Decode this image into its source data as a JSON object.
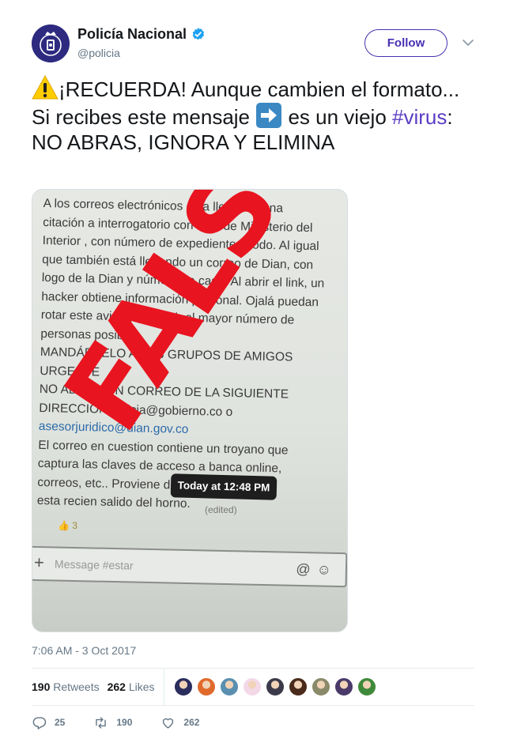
{
  "account": {
    "display_name": "Policía Nacional",
    "handle": "@policia",
    "follow_label": "Follow"
  },
  "tweet": {
    "text_part1": "¡RECUERDA! Aunque cambien el formato... Si recibes este mensaje ",
    "text_part2": " es un viejo ",
    "hashtag": "#virus",
    "text_part3": ": NO ABRAS, IGNORA Y ELIMINA",
    "emojis": [
      "warning-emoji",
      "right-arrow-emoji"
    ]
  },
  "media": {
    "lines": [
      "A los correos electrónicos esta llegando una",
      "citación a interrogatorio con logo de Ministerio del",
      "Interior , con número de expediente y todo. Al igual",
      "que también está llegando un correo de Dian, con",
      "logo de la Dian y número de caso. Al abrir el link, un",
      "hacker obtiene información personal. Ojalá puedan",
      "rotar este aviso y prevenir al mayor número de",
      "personas posible.",
      "MANDÁRSELO A LOS GRUPOS DE AMIGOS",
      "URGENTE",
      "NO ABRAN UN CORREO DE LA SIGUIENTE",
      "DIRECCION policia@gobierno.co o",
      "asesorjuridico@dian.gov.co",
      "El correo en cuestion contiene un troyano que",
      "captura las claves de acceso a banca online,",
      "correos, etc.. Proviene de Brasil, y",
      "esta recien salido del horno."
    ],
    "tooltip": "Today at 12:48 PM",
    "edited": "(edited)",
    "reaction_count": "3",
    "composer_placeholder": "Message #estar",
    "stamp": "FALSO"
  },
  "timestamp": "7:06 AM - 3 Oct 2017",
  "stats": {
    "retweets_count": "190",
    "retweets_label": "Retweets",
    "likes_count": "262",
    "likes_label": "Likes",
    "liker_colors": [
      "#2b2d5e",
      "#e06a2c",
      "#5a8fb0",
      "#f3d9e8",
      "#3a3a4a",
      "#4a2a1a",
      "#8a8a6a",
      "#4a3a6a",
      "#3f8a3a"
    ]
  },
  "actions": {
    "replies": "25",
    "retweets": "190",
    "likes": "262"
  },
  "colors": {
    "accent": "#4a2fb3",
    "hashtag": "#5b3cc4",
    "stamp": "#e8141f",
    "muted": "#657786"
  }
}
